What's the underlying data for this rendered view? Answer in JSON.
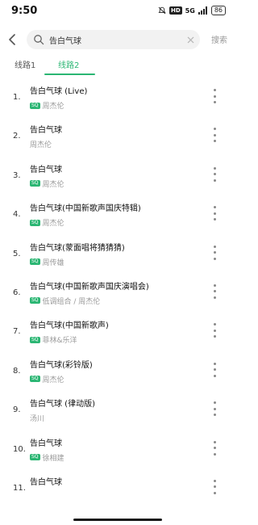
{
  "status_bar": {
    "time": "9:50",
    "hd": "HD",
    "network": "5G",
    "battery": "86"
  },
  "search": {
    "query": "告白气球",
    "button_label": "搜索"
  },
  "tabs": [
    {
      "label": "线路1",
      "active": false
    },
    {
      "label": "线路2",
      "active": true
    }
  ],
  "colors": {
    "accent": "#2bb673"
  },
  "songs": [
    {
      "index": "1.",
      "title": "告白气球 (Live)",
      "artist": "周杰伦",
      "sq": true
    },
    {
      "index": "2.",
      "title": "告白气球",
      "artist": "周杰伦",
      "sq": false
    },
    {
      "index": "3.",
      "title": "告白气球",
      "artist": "周杰伦",
      "sq": true
    },
    {
      "index": "4.",
      "title": "告白气球(中国新歌声国庆特辑)",
      "artist": "周杰伦",
      "sq": true
    },
    {
      "index": "5.",
      "title": "告白气球(蒙面唱将猜猜猜)",
      "artist": "周传雄",
      "sq": true
    },
    {
      "index": "6.",
      "title": "告白气球(中国新歌声国庆演唱会)",
      "artist": "低调组合 / 周杰伦",
      "sq": true
    },
    {
      "index": "7.",
      "title": "告白气球(中国新歌声)",
      "artist": "菲林&乐洋",
      "sq": true
    },
    {
      "index": "8.",
      "title": "告白气球(彩铃版)",
      "artist": "周杰伦",
      "sq": true
    },
    {
      "index": "9.",
      "title": "告白气球 (律动版)",
      "artist": "汤川",
      "sq": false
    },
    {
      "index": "10.",
      "title": "告白气球",
      "artist": "徐相建",
      "sq": true
    },
    {
      "index": "11.",
      "title": "告白气球",
      "artist": "",
      "sq": false
    }
  ],
  "sq_label": "SQ"
}
